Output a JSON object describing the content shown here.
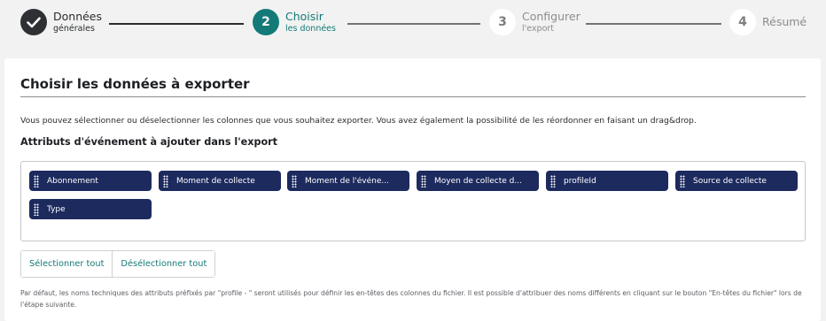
{
  "stepper": {
    "steps": [
      {
        "number": "",
        "title": "Données",
        "subtitle": "générales",
        "state": "done"
      },
      {
        "number": "2",
        "title": "Choisir",
        "subtitle": "les données",
        "state": "active"
      },
      {
        "number": "3",
        "title": "Configurer",
        "subtitle": "l'export",
        "state": "todo"
      },
      {
        "number": "4",
        "title": "Résumé",
        "subtitle": "",
        "state": "todo"
      }
    ],
    "done_icon": "check-icon"
  },
  "card": {
    "title": "Choisir les données à exporter",
    "intro": "Vous pouvez sélectionner ou déselectionner les colonnes que vous souhaitez exporter. Vous avez également la possibilité de les réordonner en faisant un drag&drop.",
    "section_title": "Attributs d'événement à ajouter dans l'export",
    "attributes": [
      "Abonnement",
      "Moment de collecte",
      "Moment de l'événe...",
      "Moyen de collecte d...",
      "profileId",
      "Source de collecte",
      "Type"
    ],
    "buttons": {
      "select_all": "Sélectionner tout",
      "deselect_all": "Désélectionner tout"
    },
    "note": "Par défaut, les noms techniques des attributs préfixés par \"profile - \" seront utilisés pour définir les en-têtes des colonnes du fichier. Il est possible d'attribuer des noms différents en cliquant sur le bouton \"En-têtes du fichier\" lors de l'étape suivante."
  },
  "colors": {
    "accent": "#147a78",
    "chip": "#1c2a5e",
    "done": "#2f3033"
  }
}
